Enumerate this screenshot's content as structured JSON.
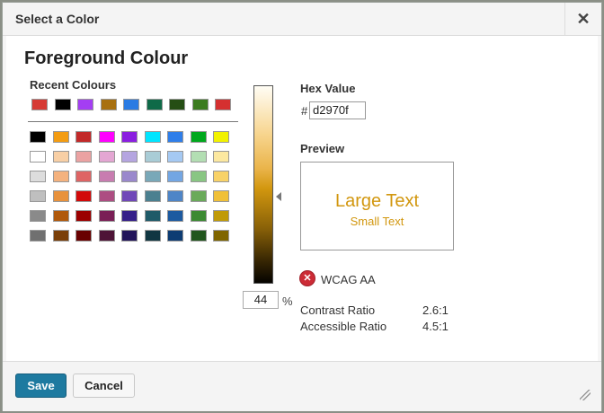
{
  "dialog": {
    "title": "Select a Color",
    "close_glyph": "✕"
  },
  "heading": "Foreground Colour",
  "recent": {
    "label": "Recent Colours",
    "colors": [
      "#d63a34",
      "#000000",
      "#a43ef3",
      "#a8700f",
      "#2a7be3",
      "#0f6a48",
      "#254e14",
      "#3c7c1f",
      "#d53030"
    ]
  },
  "palette": [
    [
      "#000000",
      "#f39c12",
      "#c22929",
      "#ff00ff",
      "#8a1ee0",
      "#00e5ff",
      "#2f7ee9",
      "#00a81d",
      "#f2f200"
    ],
    [
      "#ffffff",
      "#f8cfa5",
      "#eba2a2",
      "#e4a6d3",
      "#b5a5e0",
      "#a9ccd6",
      "#a5c9f3",
      "#b3deb3",
      "#fce8a0"
    ],
    [
      "#dddddd",
      "#f4b27e",
      "#de6464",
      "#c87cb0",
      "#9a88cc",
      "#79a8b8",
      "#73a6e3",
      "#89c683",
      "#f8d268"
    ],
    [
      "#bfbfbf",
      "#e8923d",
      "#d20a0a",
      "#ad4d82",
      "#7048b8",
      "#4b8090",
      "#4e85c7",
      "#6aaa5a",
      "#f0c038"
    ],
    [
      "#8a8a8a",
      "#b0590c",
      "#9b0000",
      "#7a1f56",
      "#351f89",
      "#1f5a68",
      "#1c5aa0",
      "#3c8a32",
      "#c09a08"
    ],
    [
      "#707070",
      "#7a3f08",
      "#690000",
      "#4e1437",
      "#21145a",
      "#103642",
      "#0d3c73",
      "#22561e",
      "#806600"
    ]
  ],
  "luminance": {
    "value": "44",
    "unit": "%"
  },
  "hex": {
    "label": "Hex Value",
    "prefix": "#",
    "value": "d2970f"
  },
  "preview": {
    "label": "Preview",
    "large_text": "Large Text",
    "small_text": "Small Text",
    "color": "#d2970f"
  },
  "wcag": {
    "label": "WCAG AA",
    "status_icon": "fail-x-icon",
    "glyph": "✕"
  },
  "ratios": {
    "contrast_label": "Contrast Ratio",
    "contrast_value": "2.6:1",
    "accessible_label": "Accessible Ratio",
    "accessible_value": "4.5:1"
  },
  "buttons": {
    "save": "Save",
    "cancel": "Cancel"
  }
}
